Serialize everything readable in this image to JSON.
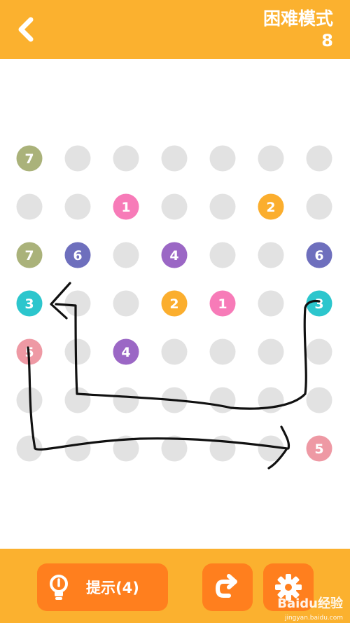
{
  "header": {
    "mode_title": "困难模式",
    "level": "8"
  },
  "board": {
    "rows": 7,
    "cols": 7,
    "empty_color": "#e2e2e2",
    "number_colors": {
      "1": "#f77bb8",
      "2": "#fbae2e",
      "3": "#2cc6cd",
      "4": "#9b67c5",
      "5": "#ee99a4",
      "6": "#6e6fbd",
      "7": "#aab27a"
    },
    "numbered_cells": [
      {
        "row": 0,
        "col": 0,
        "label": "7"
      },
      {
        "row": 1,
        "col": 2,
        "label": "1"
      },
      {
        "row": 1,
        "col": 5,
        "label": "2"
      },
      {
        "row": 2,
        "col": 0,
        "label": "7"
      },
      {
        "row": 2,
        "col": 1,
        "label": "6"
      },
      {
        "row": 2,
        "col": 3,
        "label": "4"
      },
      {
        "row": 2,
        "col": 6,
        "label": "6"
      },
      {
        "row": 3,
        "col": 0,
        "label": "3"
      },
      {
        "row": 3,
        "col": 3,
        "label": "2"
      },
      {
        "row": 3,
        "col": 4,
        "label": "1"
      },
      {
        "row": 3,
        "col": 6,
        "label": "3"
      },
      {
        "row": 4,
        "col": 0,
        "label": "5"
      },
      {
        "row": 4,
        "col": 2,
        "label": "4"
      },
      {
        "row": 6,
        "col": 6,
        "label": "5"
      }
    ]
  },
  "toolbar": {
    "hint_label": "提示(4)",
    "hint_icon": "lightbulb-icon",
    "redo_icon": "redo-arrow-icon",
    "settings_icon": "gear-icon"
  },
  "watermark": {
    "brand": "Baidu经验",
    "url": "jingyan.baidu.com"
  }
}
